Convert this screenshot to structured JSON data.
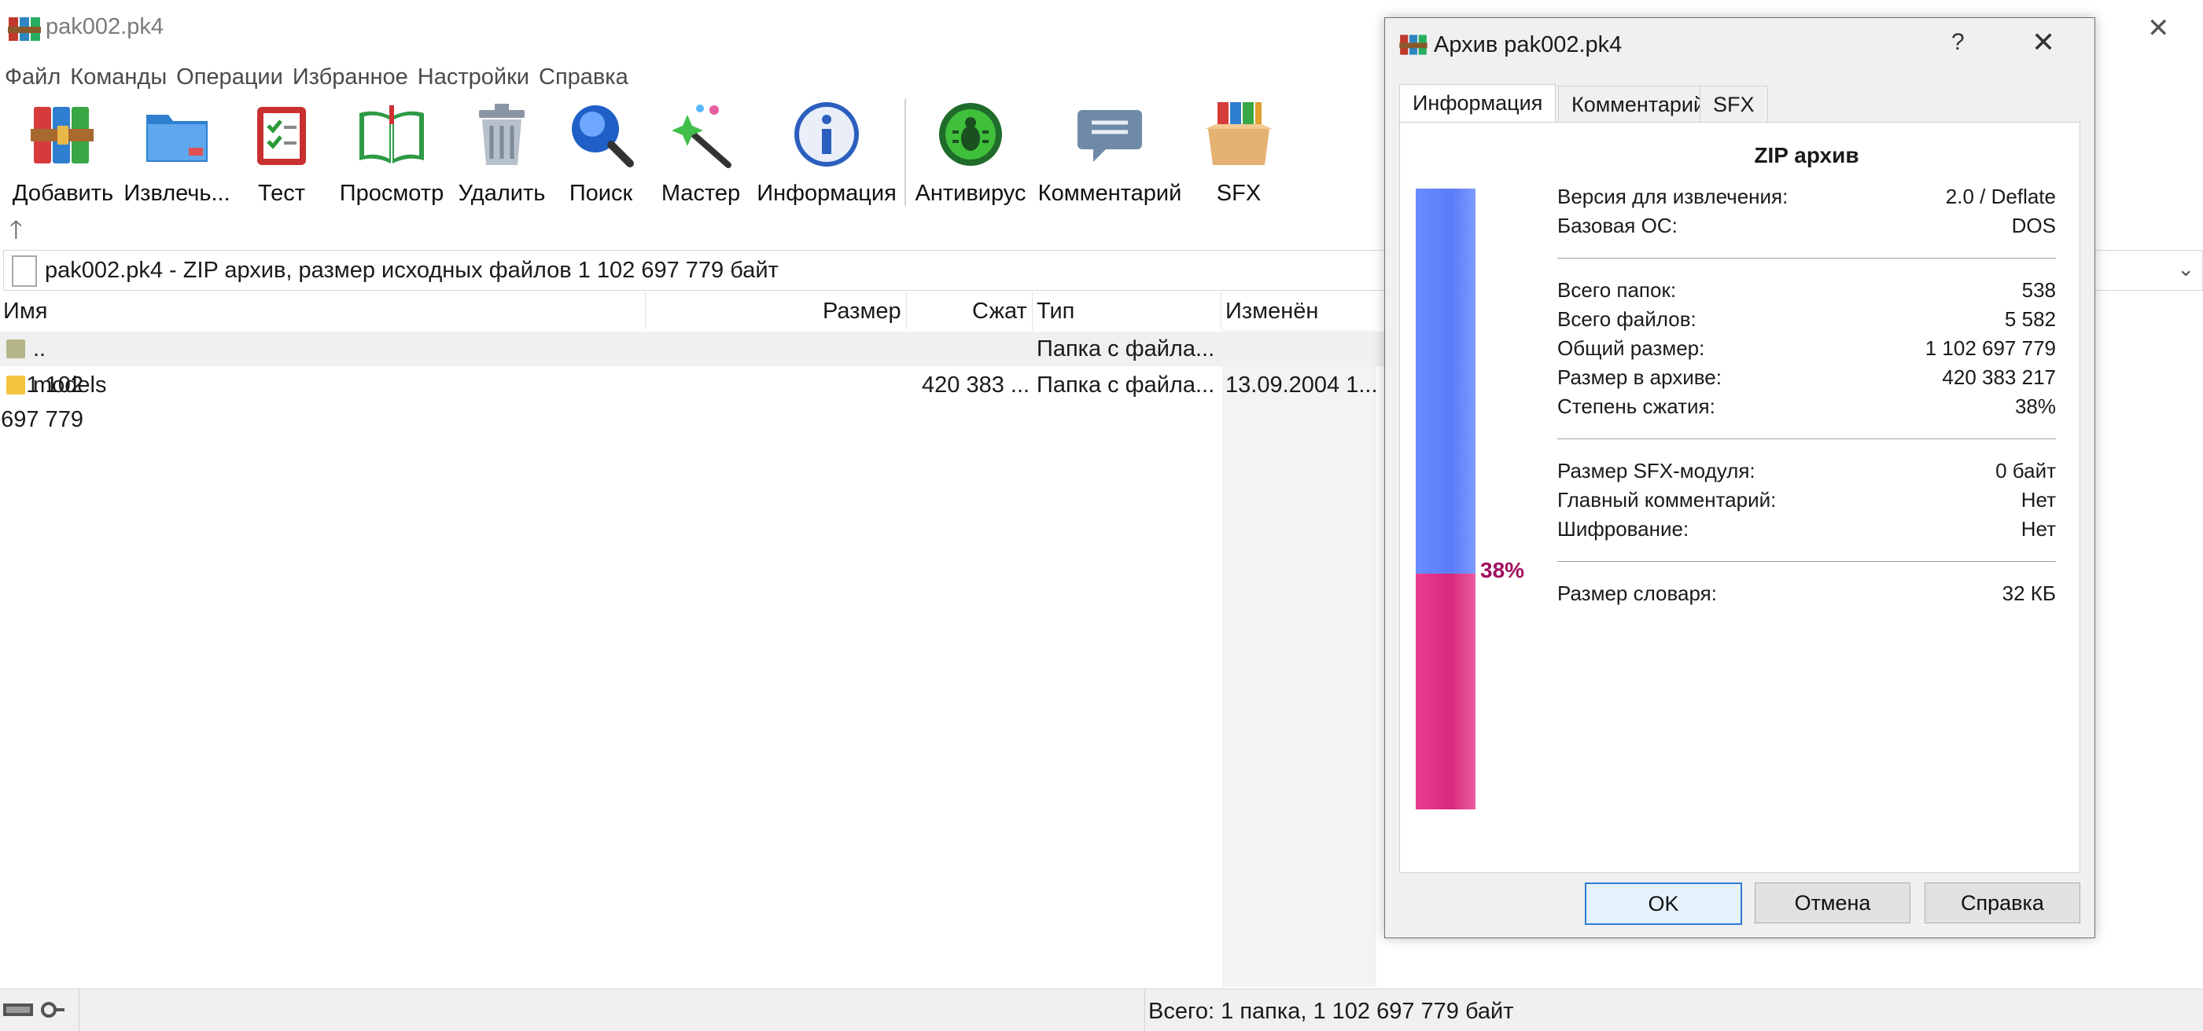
{
  "window": {
    "title": "pak002.pk4"
  },
  "menu": [
    "Файл",
    "Команды",
    "Операции",
    "Избранное",
    "Настройки",
    "Справка"
  ],
  "toolbar": [
    {
      "label": "Добавить",
      "icon": "add-archive-icon"
    },
    {
      "label": "Извлечь...",
      "icon": "extract-folder-icon"
    },
    {
      "label": "Тест",
      "icon": "test-clipboard-icon"
    },
    {
      "label": "Просмотр",
      "icon": "view-book-icon"
    },
    {
      "label": "Удалить",
      "icon": "trash-icon"
    },
    {
      "label": "Поиск",
      "icon": "magnifier-icon"
    },
    {
      "label": "Мастер",
      "icon": "wizard-wand-icon"
    },
    {
      "label": "Информация",
      "icon": "info-icon"
    },
    {
      "label": "Антивирус",
      "icon": "antivirus-bug-icon"
    },
    {
      "label": "Комментарий",
      "icon": "comment-bubble-icon"
    },
    {
      "label": "SFX",
      "icon": "sfx-box-icon"
    }
  ],
  "address": {
    "text": "pak002.pk4 - ZIP архив, размер исходных файлов 1 102 697 779 байт"
  },
  "columns": {
    "name": "Имя",
    "size": "Размер",
    "packed": "Сжат",
    "type": "Тип",
    "modified": "Изменён"
  },
  "rows": [
    {
      "name": "..",
      "size": "",
      "packed": "",
      "type": "Папка с файла...",
      "modified": ""
    },
    {
      "name": "models",
      "size": "1 102 697 779",
      "packed": "420 383 ...",
      "type": "Папка с файла...",
      "modified": "13.09.2004 1..."
    }
  ],
  "status": {
    "text": "Всего: 1 папка, 1 102 697 779 байт"
  },
  "dialog": {
    "title": "Архив pak002.pk4",
    "help_glyph": "?",
    "close_glyph": "✕",
    "tabs": [
      "Информация",
      "Комментарий",
      "SFX"
    ],
    "heading": "ZIP архив",
    "ratio_label": "38%",
    "ratio": 0.38,
    "group1": [
      {
        "k": "Версия для извлечения:",
        "v": "2.0 / Deflate"
      },
      {
        "k": "Базовая ОС:",
        "v": "DOS"
      }
    ],
    "group2": [
      {
        "k": "Всего папок:",
        "v": "538"
      },
      {
        "k": "Всего файлов:",
        "v": "5 582"
      },
      {
        "k": "Общий размер:",
        "v": "1 102 697 779"
      },
      {
        "k": "Размер в архиве:",
        "v": "420 383 217"
      },
      {
        "k": "Степень сжатия:",
        "v": "38%"
      }
    ],
    "group3": [
      {
        "k": "Размер SFX-модуля:",
        "v": "0 байт"
      },
      {
        "k": "Главный комментарий:",
        "v": "Нет"
      },
      {
        "k": "Шифрование:",
        "v": "Нет"
      }
    ],
    "group4": [
      {
        "k": "Размер словаря:",
        "v": "32 КБ"
      }
    ],
    "buttons": {
      "ok": "OK",
      "cancel": "Отмена",
      "help": "Справка"
    }
  },
  "colors": {
    "bar_compressed": "#d72a7c",
    "bar_saved": "#5b7cf7",
    "pct_text": "#a01060",
    "accent": "#2e7bd3"
  }
}
